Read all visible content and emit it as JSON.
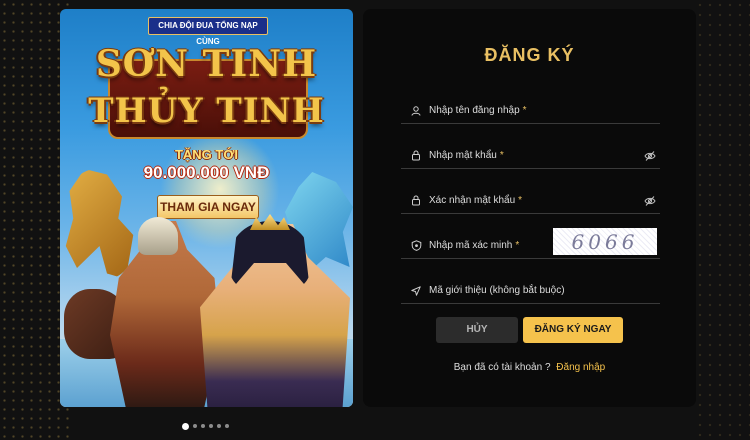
{
  "banner": {
    "promo_pill": "CHIA ĐỘI ĐUA TỔNG NẠP CÙNG",
    "title_line1": "SƠN TINH",
    "title_line2": "THỦY TINH",
    "subtitle": "TẶNG TỚI",
    "amount": "90.000.000 VNĐ",
    "join_label": "THAM GIA NGAY"
  },
  "carousel": {
    "slide_count": 6,
    "active_index": 0
  },
  "form": {
    "title": "ĐĂNG KÝ",
    "fields": [
      {
        "label": "Nhập tên đăng nhập",
        "required": "*",
        "icon": "user-icon"
      },
      {
        "label": "Nhập mật khẩu",
        "required": "*",
        "icon": "lock-icon",
        "toggle": "eye-slash-icon"
      },
      {
        "label": "Xác nhận mật khẩu",
        "required": "*",
        "icon": "lock-icon",
        "toggle": "eye-slash-icon"
      },
      {
        "label": "Nhập mã xác minh",
        "required": "*",
        "icon": "shield-icon",
        "captcha": "6066"
      },
      {
        "label": "Mã giới thiệu (không bắt buộc)",
        "required": "",
        "icon": "send-icon"
      }
    ],
    "cancel_label": "HỦY",
    "register_label": "ĐĂNG KÝ NGAY",
    "login_prompt": "Bạn đã có tài khoản ?",
    "login_link": "Đăng nhập"
  },
  "colors": {
    "accent": "#f5c24c",
    "panel_bg": "#0a0a0a",
    "page_bg": "#111111"
  }
}
